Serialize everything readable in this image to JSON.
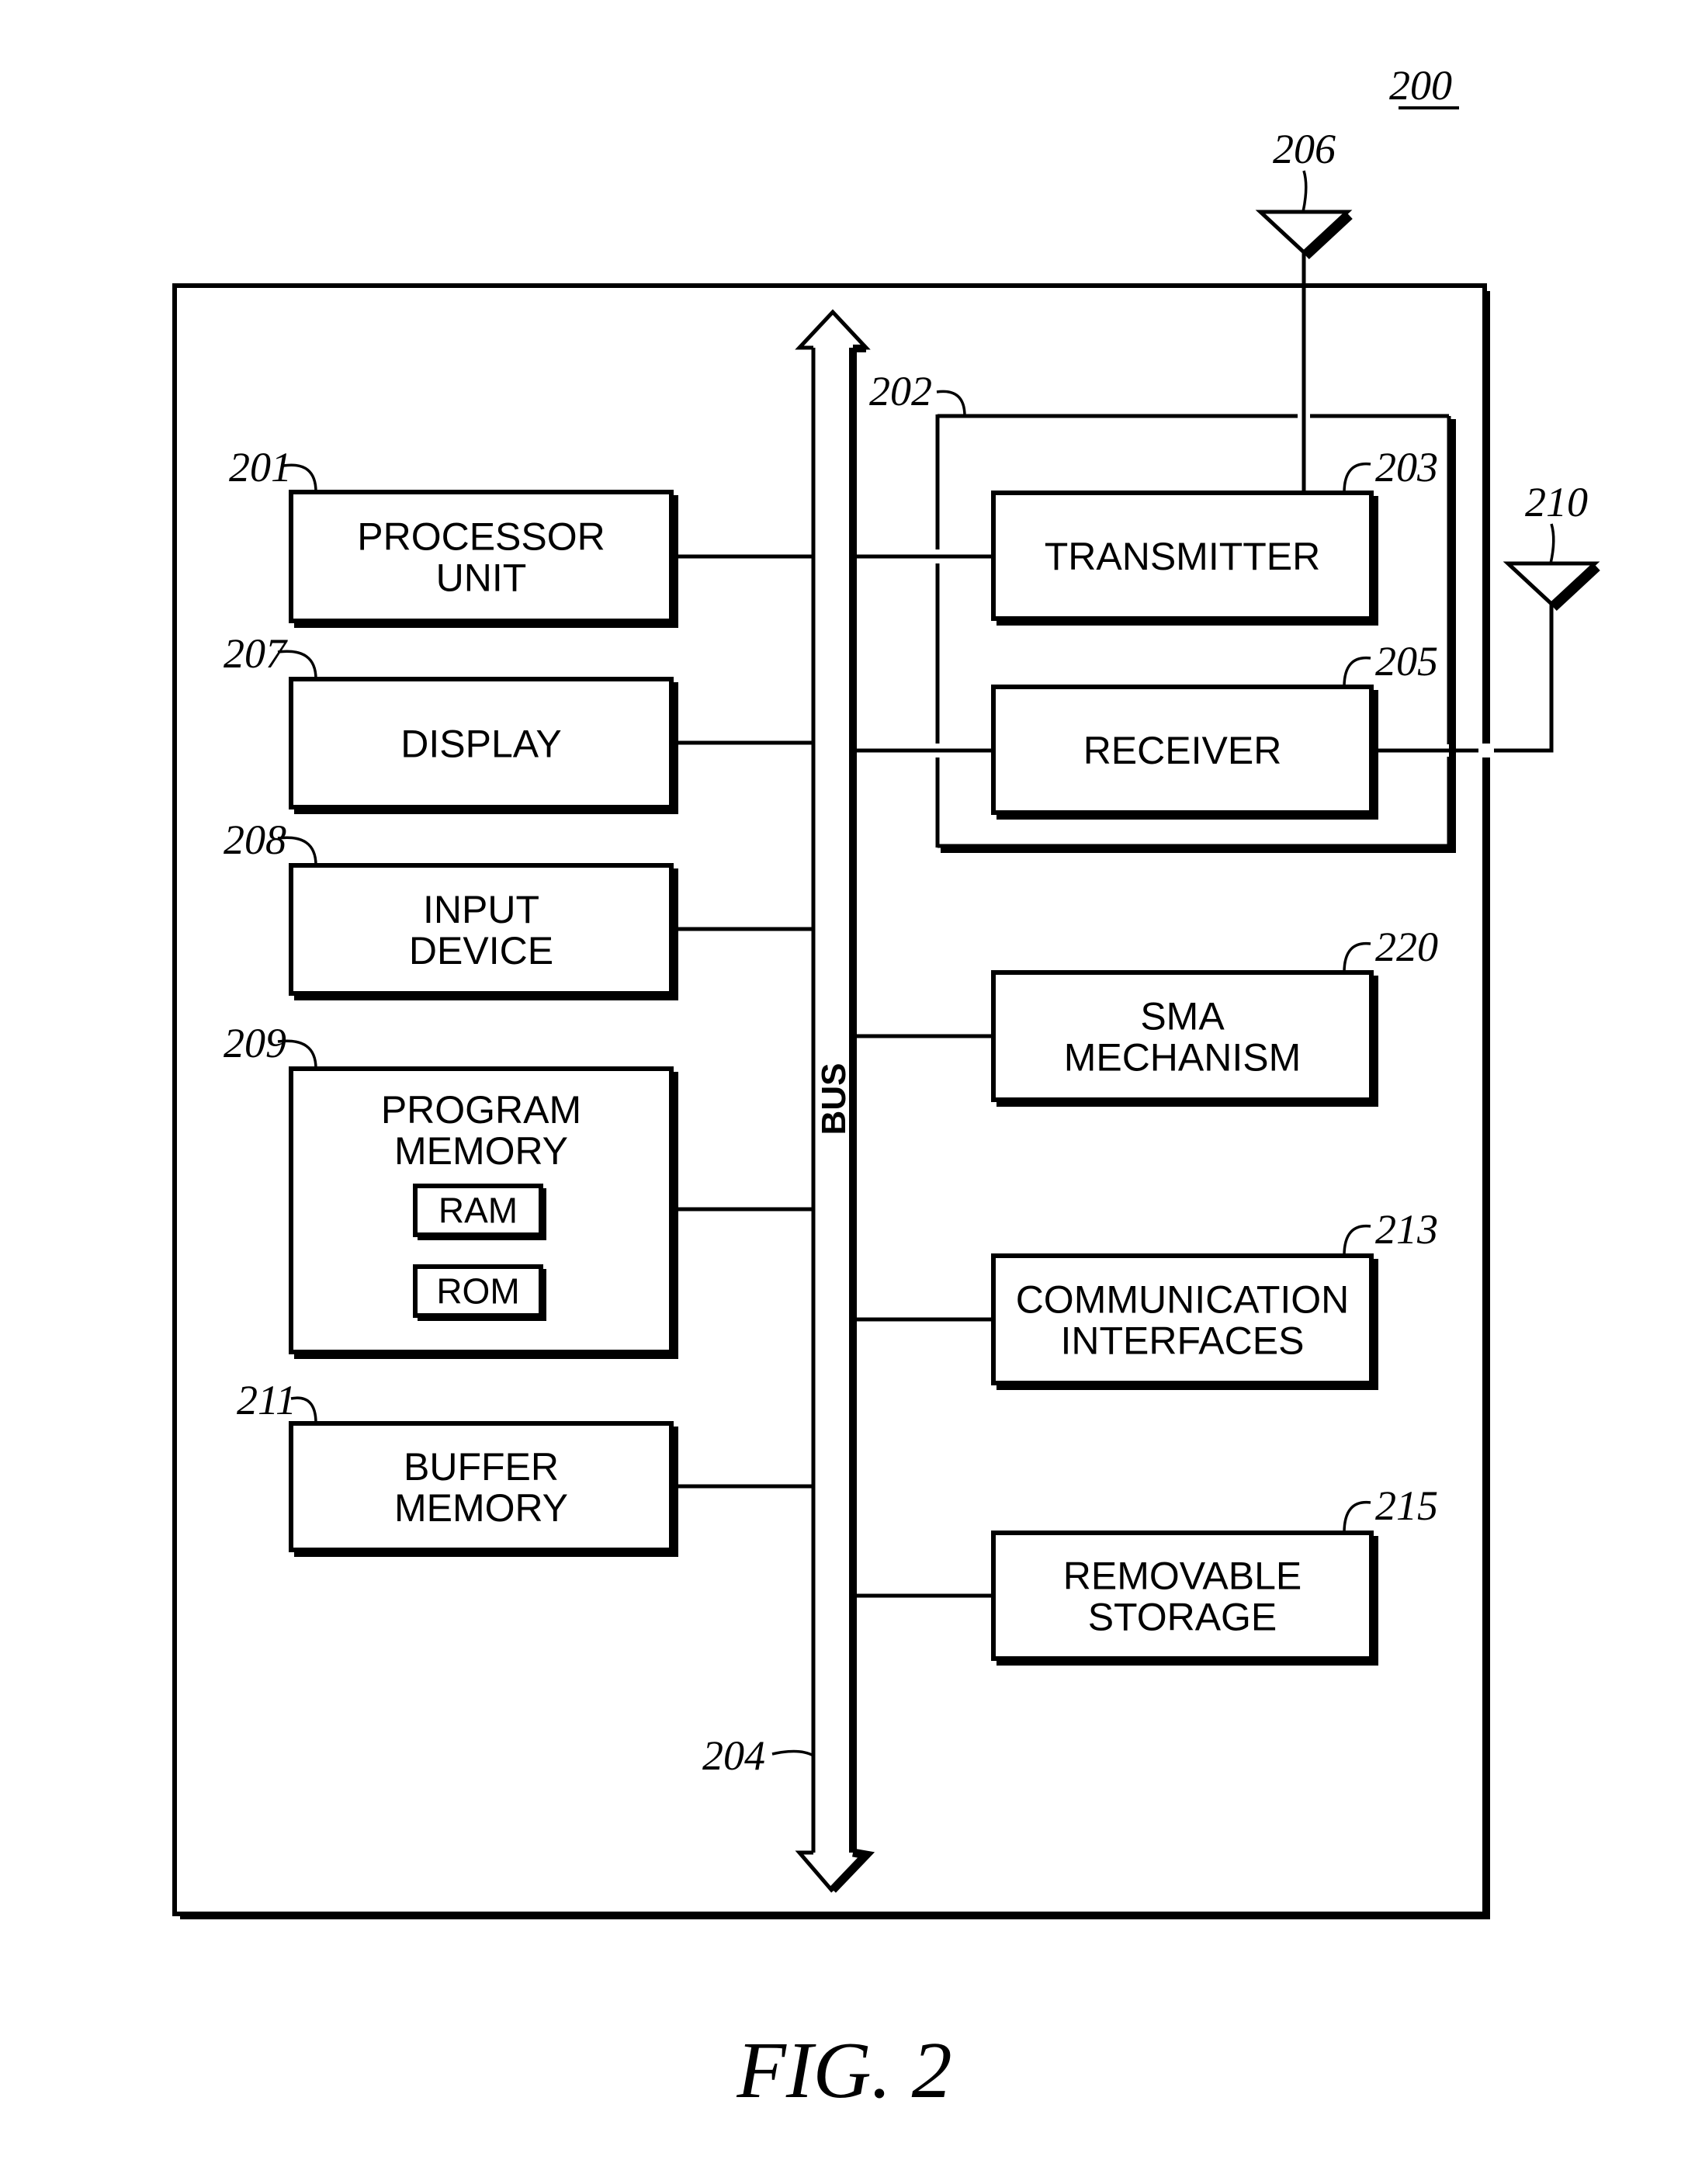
{
  "figure": {
    "ref_number": "200",
    "caption": "FIG. 2"
  },
  "bus": {
    "label": "BUS",
    "ref": "204"
  },
  "radio_group": {
    "ref": "202"
  },
  "antennas": [
    {
      "ref": "206",
      "connects_to": "transmitter"
    },
    {
      "ref": "210",
      "connects_to": "receiver"
    }
  ],
  "left_blocks": [
    {
      "id": "processor",
      "ref": "201",
      "lines": [
        "PROCESSOR",
        "UNIT"
      ]
    },
    {
      "id": "display",
      "ref": "207",
      "lines": [
        "DISPLAY"
      ]
    },
    {
      "id": "input-device",
      "ref": "208",
      "lines": [
        "INPUT",
        "DEVICE"
      ]
    },
    {
      "id": "program-memory",
      "ref": "209",
      "lines": [
        "PROGRAM",
        "MEMORY"
      ],
      "sub_blocks": [
        "RAM",
        "ROM"
      ]
    },
    {
      "id": "buffer-memory",
      "ref": "211",
      "lines": [
        "BUFFER",
        "MEMORY"
      ]
    }
  ],
  "right_blocks": [
    {
      "id": "transmitter",
      "ref": "203",
      "lines": [
        "TRANSMITTER"
      ]
    },
    {
      "id": "receiver",
      "ref": "205",
      "lines": [
        "RECEIVER"
      ]
    },
    {
      "id": "sma-mechanism",
      "ref": "220",
      "lines": [
        "SMA",
        "MECHANISM"
      ]
    },
    {
      "id": "communication-interfaces",
      "ref": "213",
      "lines": [
        "COMMUNICATION",
        "INTERFACES"
      ]
    },
    {
      "id": "removable-storage",
      "ref": "215",
      "lines": [
        "REMOVABLE",
        "STORAGE"
      ]
    }
  ]
}
